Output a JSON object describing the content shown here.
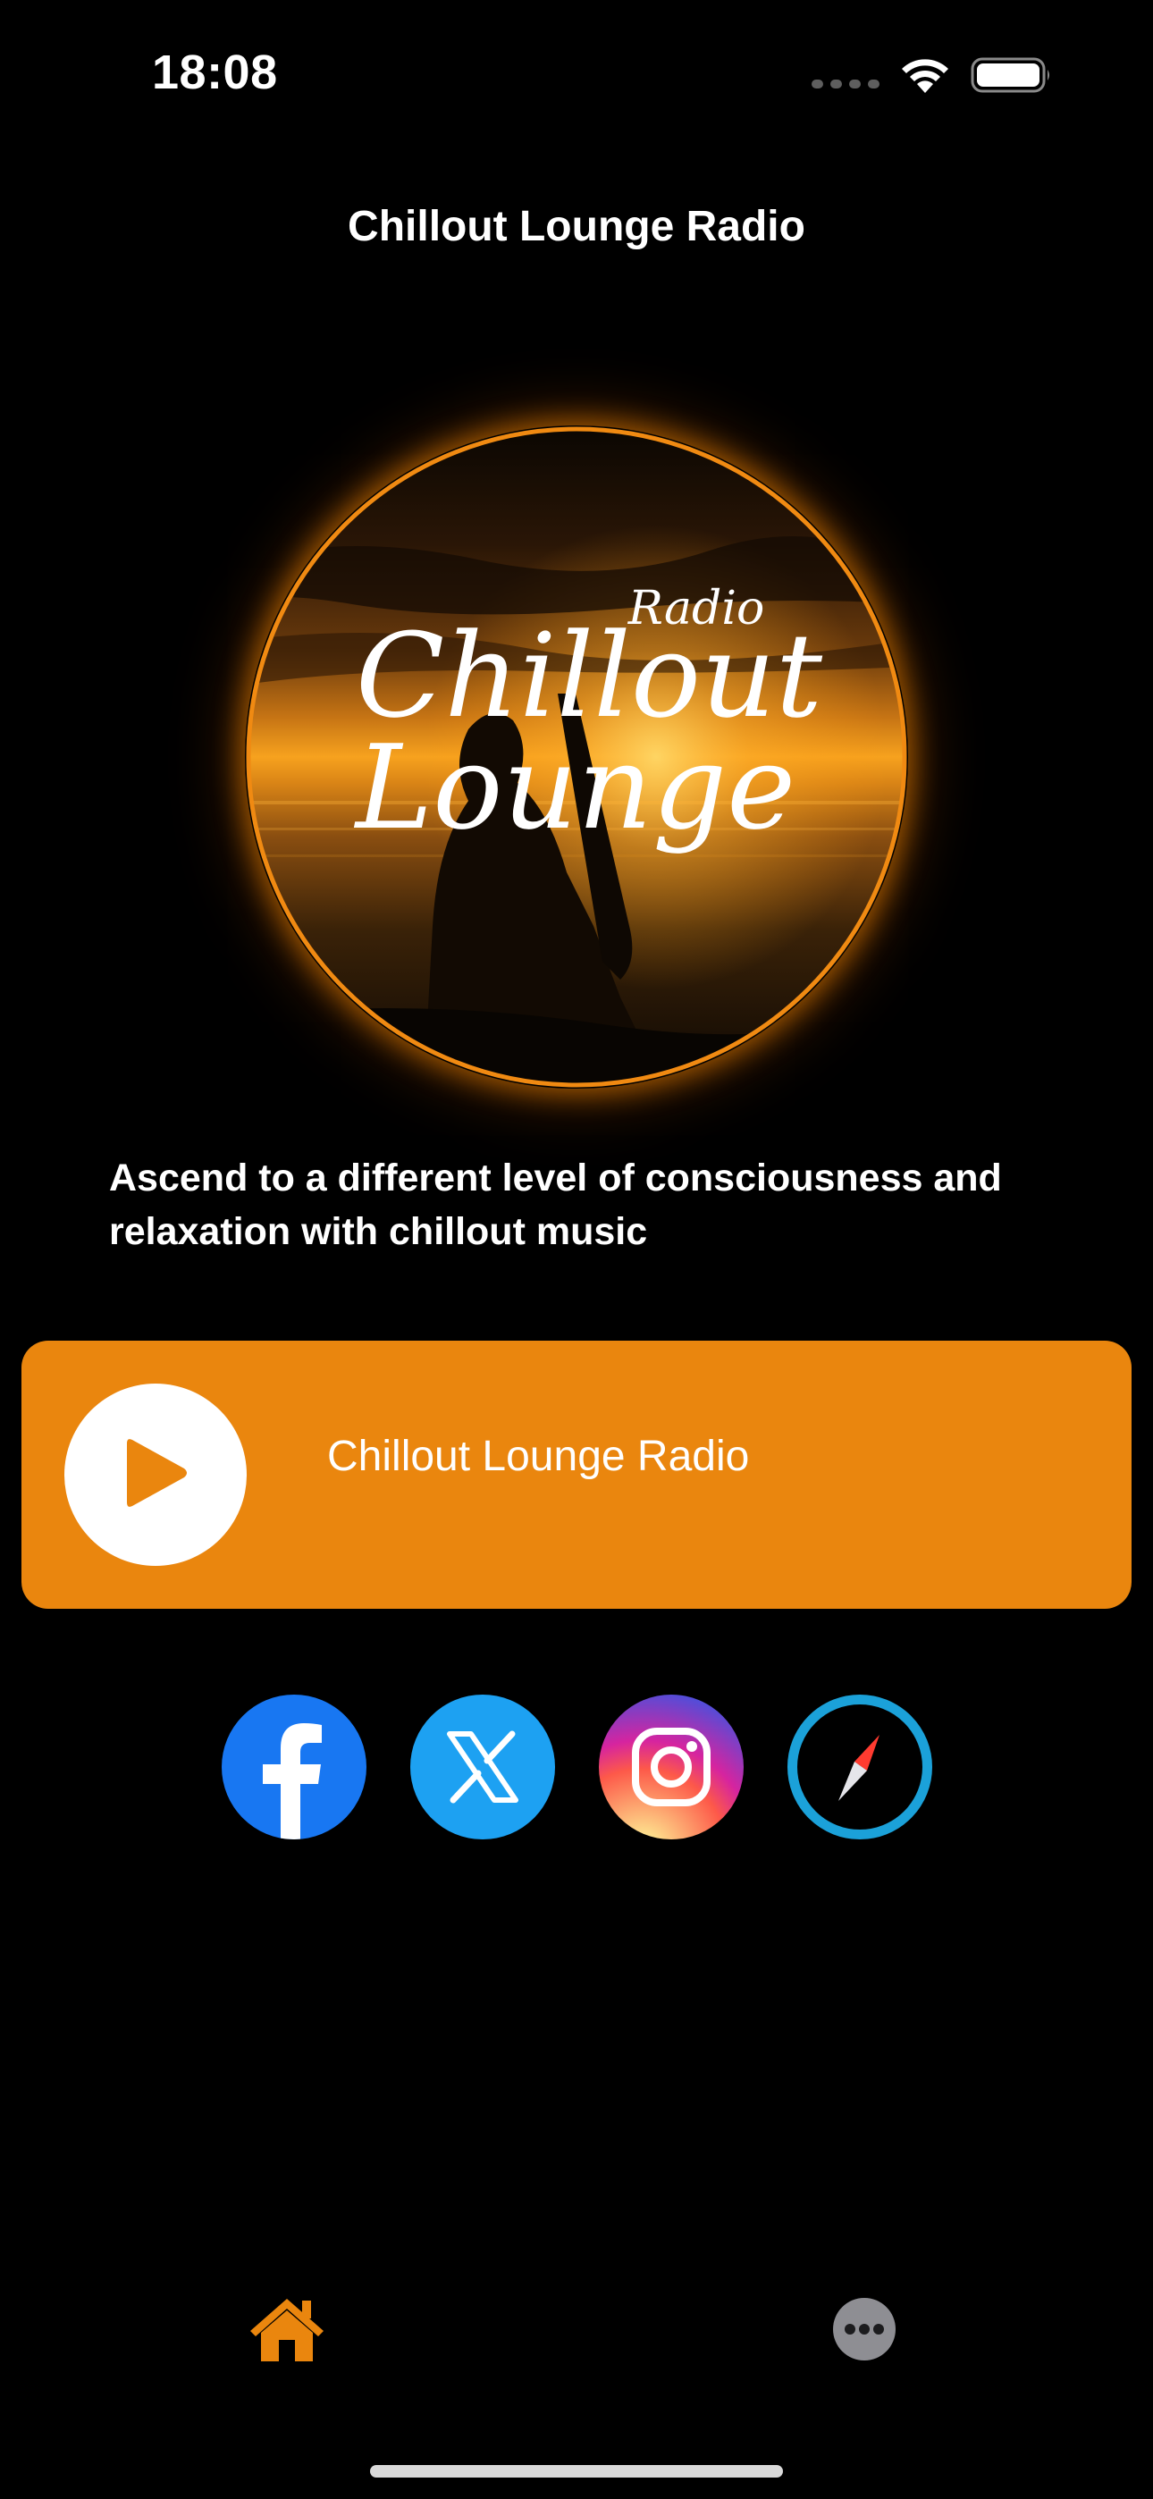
{
  "status_bar": {
    "time": "18:08"
  },
  "header": {
    "title": "Chillout Lounge Radio"
  },
  "logo": {
    "word_small": "Radio",
    "word_line1": "Chillout",
    "word_line2": "Lounge"
  },
  "description": "Ascend to a different level of consciousness and relaxation with chillout music",
  "player": {
    "station_name": "Chillout Lounge Radio",
    "accent_color": "#ea860e"
  },
  "social": [
    {
      "name": "facebook",
      "icon": "facebook-icon",
      "color": "#1877f2"
    },
    {
      "name": "x",
      "icon": "x-icon",
      "color": "#1da1f2"
    },
    {
      "name": "instagram",
      "icon": "instagram-icon"
    },
    {
      "name": "website",
      "icon": "compass-icon",
      "color": "#1ba1d9"
    }
  ],
  "tab_bar": {
    "items": [
      {
        "name": "home",
        "icon": "home-icon",
        "active": true,
        "color": "#ea860e"
      },
      {
        "name": "more",
        "icon": "more-icon",
        "active": false,
        "color": "#8e8e93"
      }
    ]
  }
}
